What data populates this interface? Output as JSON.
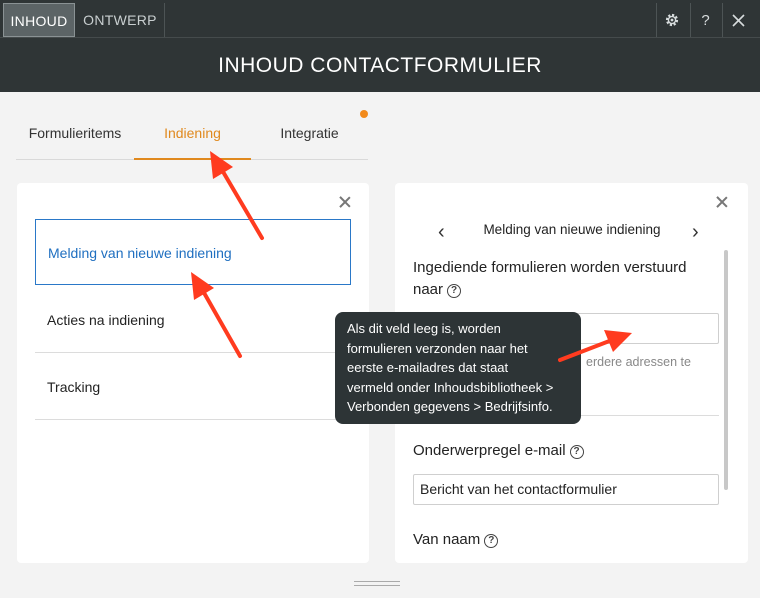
{
  "topbar": {
    "tabs": [
      {
        "label": "INHOUD",
        "active": true
      },
      {
        "label": "ONTWERP",
        "active": false
      }
    ],
    "icons": {
      "settings": "gear-icon",
      "help_label": "?",
      "close": "close-icon"
    }
  },
  "header": {
    "title": "INHOUD CONTACTFORMULIER"
  },
  "subtabs": [
    {
      "label": "Formulieritems",
      "active": false
    },
    {
      "label": "Indiening",
      "active": true
    },
    {
      "label": "Integratie",
      "active": false
    }
  ],
  "colors": {
    "accent": "#e0891e",
    "selected": "#2a78c8",
    "arrow": "#ff3b1f",
    "dark": "#2f3536"
  },
  "left_panel": {
    "items": [
      {
        "label": "Melding van nieuwe indiening",
        "active": true
      },
      {
        "label": "Acties na indiening",
        "active": false
      },
      {
        "label": "Tracking",
        "active": false
      }
    ]
  },
  "right_panel": {
    "nav_title": "Melding van nieuwe indiening",
    "recipients": {
      "label_line1": "Ingediende formulieren worden verstuurd",
      "label_line2": "naar",
      "value": "",
      "hint": "erdere adressen te"
    },
    "subject": {
      "label": "Onderwerpregel e-mail",
      "value": "Bericht van het contactformulier"
    },
    "from_name": {
      "label": "Van naam"
    }
  },
  "tooltip": {
    "lines": [
      "Als dit veld leeg is, worden",
      "formulieren verzonden naar het",
      "eerste e-mailadres dat staat",
      "vermeld onder Inhoudsbibliotheek >",
      "Verbonden gegevens > Bedrijfsinfo."
    ]
  }
}
